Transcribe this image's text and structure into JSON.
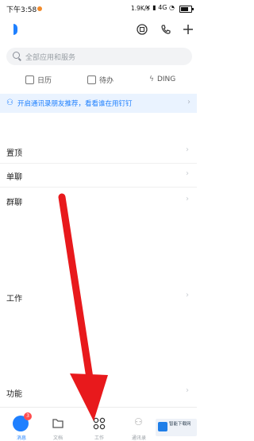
{
  "status_bar": {
    "time": "下午3:58",
    "speed": "1.9K/s",
    "network": "4G"
  },
  "search": {
    "placeholder": "全部应用和服务"
  },
  "quick_actions": [
    {
      "label": "日历",
      "icon": "calendar-icon"
    },
    {
      "label": "待办",
      "icon": "todo-icon"
    },
    {
      "label": "DING",
      "icon": "ding-icon"
    }
  ],
  "banner": {
    "text": "开启通讯录朋友推荐，看看谁在用钉钉",
    "icon": "user-plus-icon"
  },
  "sections": {
    "pinned": "置顶",
    "single_chat": "单聊",
    "group_chat": "群聊",
    "work": "工作",
    "features": "功能"
  },
  "bottom_nav": [
    {
      "label": "消息",
      "icon": "message-icon",
      "badge": "3",
      "active": true
    },
    {
      "label": "文档",
      "icon": "docs-icon"
    },
    {
      "label": "工作",
      "icon": "grid-icon"
    },
    {
      "label": "通讯录",
      "icon": "contacts-icon"
    }
  ],
  "watermark": {
    "text": "智能下载网"
  },
  "colors": {
    "accent": "#1f80ff",
    "arrow": "#e8191c",
    "badge": "#ff4d4f"
  }
}
